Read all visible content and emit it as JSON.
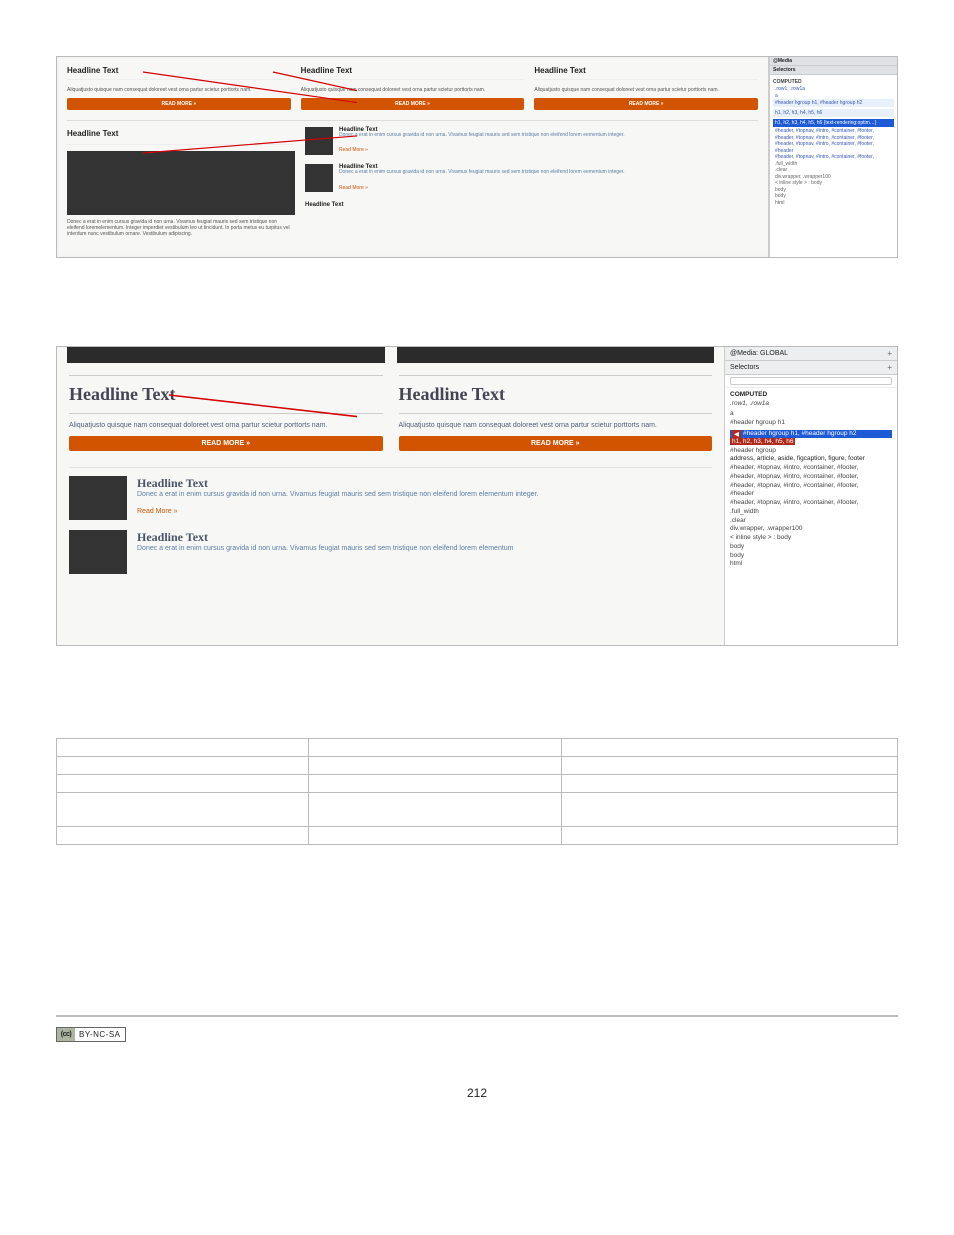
{
  "page_number": "212",
  "license_badge": {
    "left": "(cc)",
    "right": "BY-NC-SA"
  },
  "screenshot1": {
    "top_row": [
      {
        "headline": "Headline Text",
        "blurb": "Aliquatjusto quisque nam consequat doloreet vest orna partur scietur porttorts nam.",
        "button": "READ MORE »"
      },
      {
        "headline": "Headline Text",
        "blurb": "Aliquatjusto quisque nam consequat doloreet vest orna partur scietur porttorts nam.",
        "button": "READ MORE »"
      },
      {
        "headline": "Headline Text",
        "blurb": "Aliquatjusto quisque nam consequat doloreet vest orna partur scietur porttorts nam.",
        "button": "READ MORE »"
      }
    ],
    "big_column": {
      "headline": "Headline Text",
      "caption": "Donec a erat in enim cursus gravida id non urna. Vivamus feugiat mauris sed sem tristique non eleifend loremelementum. Integer imperdiet vestibulum leo ut tincidunt. In porta metus eu turpitus vel interdum nunc vestibulum ornare. Vestibulum adipiscing."
    },
    "side_items": [
      {
        "headline": "Headline Text",
        "text": "Donec a erat in enim cursus gravida id non urna. Vivamus feugiat mauris sed sem tristique non eleifend lorem eementum integer.",
        "readmore": "Read More »"
      },
      {
        "headline": "Headline Text",
        "text": "Donec a erat in enim cursus gravida id non urna. Vivamus feugiat mauris sed sem tristique non eleifend lorem eementum integer.",
        "readmore": "Read More »"
      },
      {
        "headline": "Headline Text",
        "text": "",
        "readmore": ""
      }
    ],
    "dev_panel": {
      "tab1": "@Media",
      "tab2": "Selectors",
      "computed": "COMPUTED",
      "row1": ".row1, .row1a",
      "a": "a",
      "blue1": "#header hgroup h1, #header hgroup h2",
      "blue2": "h1, h2, h3, h4, h5, h6",
      "selected": "h1, h2, h3, h4, h5, h6 {text-rendering:optim…}",
      "lines": [
        "#header, #topnav, #intro, #container, #footer,",
        "#header, #topnav, #intro, #container, #footer,",
        "#header, #topnav, #intro, #container, #footer,",
        "#header",
        "#header, #topnav, #intro, #container, #footer,",
        ".full_width",
        ".clear",
        "div.wrapper, .wrapper100",
        "< inline style > : body",
        "body",
        "body",
        "html"
      ]
    }
  },
  "screenshot2": {
    "cols": [
      {
        "headline": "Headline Text",
        "blurb": "Aliquatjusto quisque nam consequat doloreet vest orna partur scietur porttorts nam.",
        "button": "READ MORE »"
      },
      {
        "headline": "Headline Text",
        "blurb": "Aliquatjusto quisque nam consequat doloreet vest orna partur scietur porttorts nam.",
        "button": "READ MORE »"
      }
    ],
    "list_items": [
      {
        "headline": "Headline Text",
        "text": "Donec a erat in enim cursus gravida id non urna. Vivamus feugiat mauris sed sem tristique non eleifend lorem elementum integer.",
        "readmore": "Read More »"
      },
      {
        "headline": "Headline Text",
        "text": "Donec a erat in enim cursus gravida id non urna. Vivamus feugiat mauris sed sem tristique non eleifend lorem elementum",
        "readmore": ""
      }
    ],
    "dev_panel": {
      "media_head": "@Media: GLOBAL",
      "selectors_head": "Selectors",
      "computed": "COMPUTED",
      "row1": ".row1, .row1a",
      "a": "a",
      "hgroup_h1": "#header hgroup h1",
      "selected_top_left": "#header hgroup h1, #header hgroup h2",
      "selected_bot": "h1, h2, h3, h4, h5, h6",
      "hgroup": "#header hgroup",
      "lines": [
        "address, article, aside, figcaption, figure, footer",
        "#header, #topnav, #intro, #container, #footer,",
        "#header, #topnav, #intro, #container, #footer,",
        "#header, #topnav, #intro, #container, #footer,",
        "#header",
        "#header, #topnav, #intro, #container, #footer,",
        ".full_width",
        ".clear",
        "div.wrapper, .wrapper100",
        "< inline style > : body",
        "body",
        "body",
        "html"
      ]
    }
  }
}
